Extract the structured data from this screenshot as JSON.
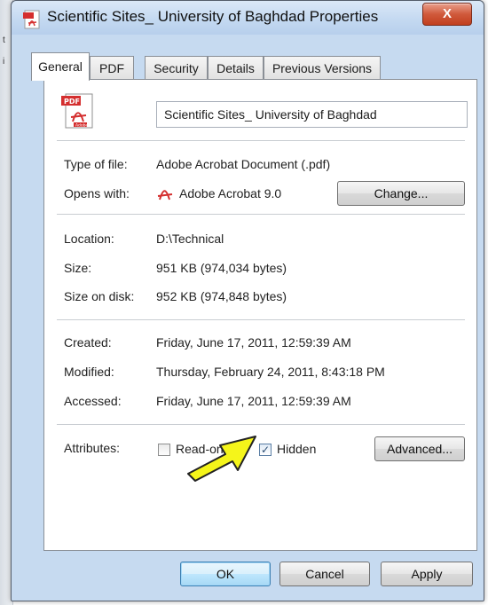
{
  "window": {
    "title": "Scientific Sites_ University of Baghdad Properties",
    "close_label": "X"
  },
  "tabs": [
    {
      "label": "General",
      "active": true
    },
    {
      "label": "PDF",
      "active": false
    },
    {
      "label": "Security",
      "active": false
    },
    {
      "label": "Details",
      "active": false
    },
    {
      "label": "Previous Versions",
      "active": false
    }
  ],
  "general": {
    "file_icon_label": "PDF",
    "file_icon_caption": "Adobe",
    "filename": "Scientific Sites_ University of Baghdad",
    "type_label": "Type of file:",
    "type_value": "Adobe Acrobat Document (.pdf)",
    "opens_label": "Opens with:",
    "opens_value": "Adobe Acrobat 9.0",
    "change_button": "Change...",
    "location_label": "Location:",
    "location_value": "D:\\Technical",
    "size_label": "Size:",
    "size_value": "951 KB (974,034 bytes)",
    "size_on_disk_label": "Size on disk:",
    "size_on_disk_value": "952 KB (974,848 bytes)",
    "created_label": "Created:",
    "created_value": "Friday, June 17, 2011, 12:59:39 AM",
    "modified_label": "Modified:",
    "modified_value": "Thursday, February 24, 2011, 8:43:18 PM",
    "accessed_label": "Accessed:",
    "accessed_value": "Friday, June 17, 2011, 12:59:39 AM",
    "attributes_label": "Attributes:",
    "readonly_label": "Read-only",
    "readonly_checked": false,
    "hidden_label": "Hidden",
    "hidden_checked": true,
    "advanced_button": "Advanced..."
  },
  "buttons": {
    "ok": "OK",
    "cancel": "Cancel",
    "apply": "Apply"
  },
  "colors": {
    "window_frame": "#c6daf0",
    "close_button": "#c94a2b",
    "annotation_arrow": "#f5f51a",
    "pdf_red": "#d42e2e"
  }
}
